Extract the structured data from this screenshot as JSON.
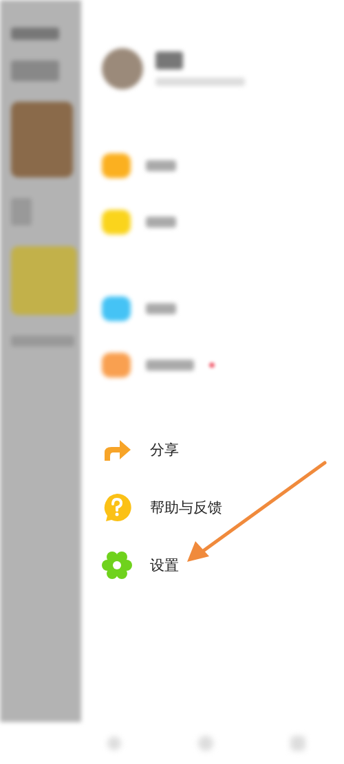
{
  "blurred_items": [
    {
      "color": "#fbb020"
    },
    {
      "color": "#fad41c"
    },
    {
      "color": "#45c3f5"
    },
    {
      "color": "#f9a050"
    }
  ],
  "items": [
    {
      "kind": "share",
      "label": "分享"
    },
    {
      "kind": "help",
      "label": "帮助与反馈"
    },
    {
      "kind": "settings",
      "label": "设置"
    }
  ],
  "annotation": {
    "kind": "arrow",
    "color": "#f08a3c"
  }
}
